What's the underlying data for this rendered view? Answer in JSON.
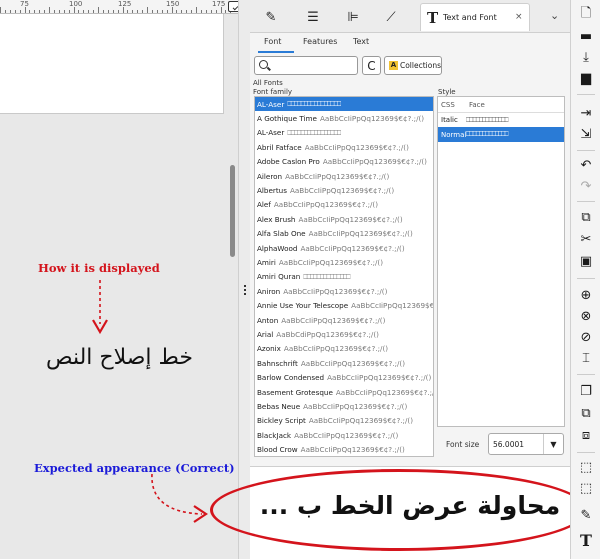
{
  "ruler": {
    "marks": [
      "75",
      "100",
      "125",
      "150",
      "175"
    ]
  },
  "annotations": {
    "how_displayed": "How it is displayed",
    "displayed_text": "خط إصلاح النص",
    "expected": "Expected appearance (Correct)",
    "expected_text": "محاولة عرض الخط ب ..."
  },
  "dock": {
    "tab_title": "Text and Font",
    "close": "×",
    "menu": "⌄"
  },
  "subtabs": [
    "Font",
    "Features",
    "Text"
  ],
  "toolbar": {
    "refresh": "C",
    "collections_icon": "A",
    "collections_label": "Collections"
  },
  "labels": {
    "all_fonts": "All Fonts",
    "font_family": "Font family",
    "style": "Style",
    "css": "CSS",
    "face": "Face",
    "font_size": "Font size"
  },
  "font_size_value": "56.0001",
  "sample_text": "AaBbCcIiPpQq12369$€¢?.;/()",
  "fonts": [
    {
      "name": "AL-Aser",
      "boxes": "⎕⎕⎕⎕⎕⎕⎕⎕⎕⎕⎕⎕⎕⎕⎕⎕",
      "selected": true
    },
    {
      "name": "A Gothique Time",
      "sample": "AaBbCcIiPpQq12369$€¢?.;/()"
    },
    {
      "name": "AL-Aser",
      "boxes": "⎕⎕⎕⎕⎕⎕⎕⎕⎕⎕⎕⎕⎕⎕⎕⎕"
    },
    {
      "name": "Abril Fatface",
      "sample": "AaBbCcIiPpQq12369$€¢?.;/()"
    },
    {
      "name": "Adobe Caslon Pro",
      "sample": "AaBbCcIiPpQq12369$€¢?.;/()"
    },
    {
      "name": "Aileron",
      "sample": "AaBbCcIiPpQq12369$€¢?.;/()"
    },
    {
      "name": "Albertus",
      "sample": "AaBbCcIiPpQq12369$€¢?.;/()"
    },
    {
      "name": "Alef",
      "sample": "AaBbCcIiPpQq12369$€¢?.;/()"
    },
    {
      "name": "Alex Brush",
      "sample": "AaBbCcIiPpQq12369$€¢?.;/()"
    },
    {
      "name": "Alfa Slab One",
      "sample": "AaBbCcIiPpQq12369$€¢?.;/()"
    },
    {
      "name": "AlphaWood",
      "sample": "AaBbCcIiPpQq12369$€¢?.;/()"
    },
    {
      "name": "Amiri",
      "sample": "AaBbCcIiPpQq12369$€¢?.;/()"
    },
    {
      "name": "Amiri Quran",
      "boxes": "⎕⎕⎕⎕⎕⎕⎕⎕⎕⎕⎕⎕⎕⎕"
    },
    {
      "name": "Aniron",
      "sample": "AaBbCcIiPpQq12369$€¢?.;/()"
    },
    {
      "name": "Annie Use Your Telescope",
      "sample": "AaBbCcIiPpQq12369$€"
    },
    {
      "name": "Anton",
      "sample": "AaBbCcIiPpQq12369$€¢?.;/()"
    },
    {
      "name": "Arial",
      "sample": "AaBbCdiPpQq12369$€¢?.;/()"
    },
    {
      "name": "Azonix",
      "sample": "AaBbCcIiPpQq12369$€¢?.;/()"
    },
    {
      "name": "Bahnschrift",
      "sample": "AaBbCcIiPpQq12369$€¢?.;/()"
    },
    {
      "name": "Barlow Condensed",
      "sample": "AaBbCcIiPpQq12369$€¢?.;/()"
    },
    {
      "name": "Basement Grotesque",
      "sample": "AaBbCcIiPpQq12369$€¢?.;/"
    },
    {
      "name": "Bebas Neue",
      "sample": "AaBbCcIiPpQq12369$€¢?.;/()"
    },
    {
      "name": "Bickley Script",
      "sample": "AaBbCcIiPpQq12369$€¢?.;/()"
    },
    {
      "name": "BlackJack",
      "sample": "AaBbCcIiPpQq12369$€¢?.;/()"
    },
    {
      "name": "Blood Crow",
      "sample": "AaBbCcIiPpQq12369$€¢?.;/()"
    }
  ],
  "styles": [
    {
      "css": "Italic",
      "face": "⎕⎕⎕⎕⎕⎕⎕⎕⎕⎕⎕⎕⎕"
    },
    {
      "css": "Normal",
      "face": "⎕⎕⎕⎕⎕⎕⎕⎕⎕⎕⎕⎕⎕",
      "selected": true
    }
  ],
  "colors": {
    "accent": "#2a7bd6",
    "annotation_red": "#d4141c",
    "annotation_blue": "#1a1ad8"
  }
}
